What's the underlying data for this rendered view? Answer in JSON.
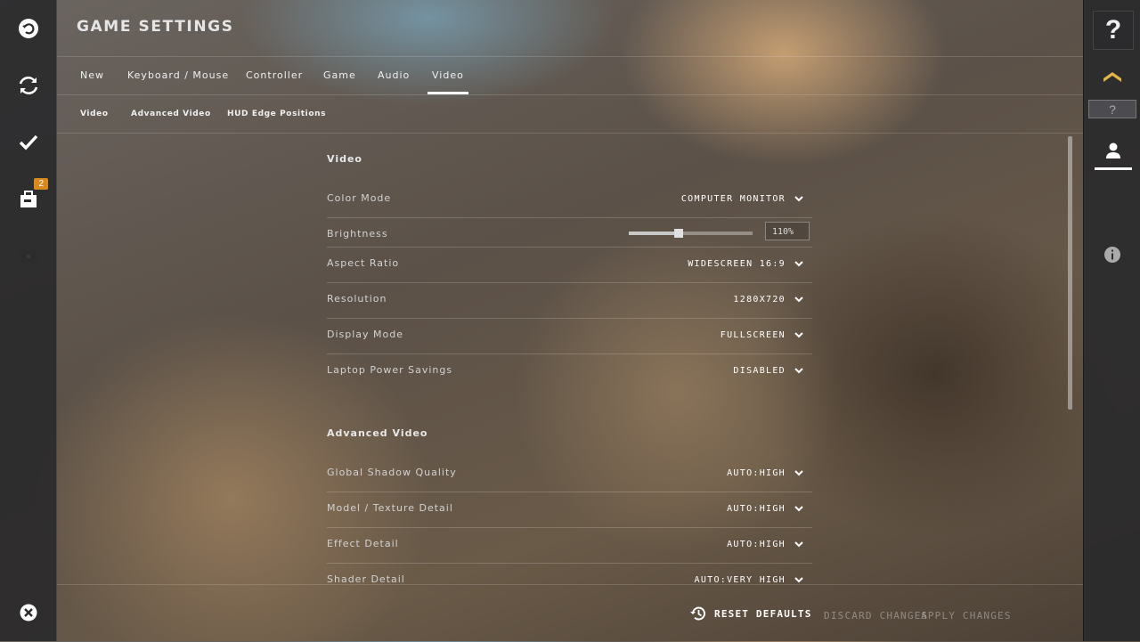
{
  "header": {
    "title": "GAME SETTINGS"
  },
  "tabs": [
    {
      "label": "New"
    },
    {
      "label": "Keyboard / Mouse"
    },
    {
      "label": "Controller"
    },
    {
      "label": "Game"
    },
    {
      "label": "Audio"
    },
    {
      "label": "Video"
    }
  ],
  "active_tab": "Video",
  "subtabs": [
    {
      "label": "Video"
    },
    {
      "label": "Advanced Video"
    },
    {
      "label": "HUD Edge Positions"
    }
  ],
  "left_bar": {
    "icons": [
      "return-icon",
      "refresh-icon",
      "checkmark-icon",
      "inventory-icon",
      "gear-icon",
      "close-icon"
    ],
    "inventory_badge": "2"
  },
  "right_bar": {
    "help": "?",
    "rank_placeholder": "?"
  },
  "sections": {
    "video": {
      "title": "Video",
      "color_mode": {
        "label": "Color Mode",
        "value": "COMPUTER MONITOR"
      },
      "brightness": {
        "label": "Brightness",
        "value": "110%",
        "level": 0.4
      },
      "aspect_ratio": {
        "label": "Aspect Ratio",
        "value": "WIDESCREEN 16:9"
      },
      "resolution": {
        "label": "Resolution",
        "value": "1280X720"
      },
      "display_mode": {
        "label": "Display Mode",
        "value": "FULLSCREEN"
      },
      "laptop_power": {
        "label": "Laptop Power Savings",
        "value": "DISABLED"
      }
    },
    "advanced": {
      "title": "Advanced Video",
      "shadow": {
        "label": "Global Shadow Quality",
        "value": "AUTO:HIGH"
      },
      "texture": {
        "label": "Model / Texture Detail",
        "value": "AUTO:HIGH"
      },
      "effect": {
        "label": "Effect Detail",
        "value": "AUTO:HIGH"
      },
      "shader": {
        "label": "Shader Detail",
        "value": "AUTO:VERY HIGH"
      }
    }
  },
  "footer": {
    "reset": "RESET DEFAULTS",
    "discard": "DISCARD CHANGES",
    "apply": "APPLY CHANGES"
  },
  "colors": {
    "accent_badge": "#d98a1e",
    "rank_chevron": "#e2b548"
  }
}
